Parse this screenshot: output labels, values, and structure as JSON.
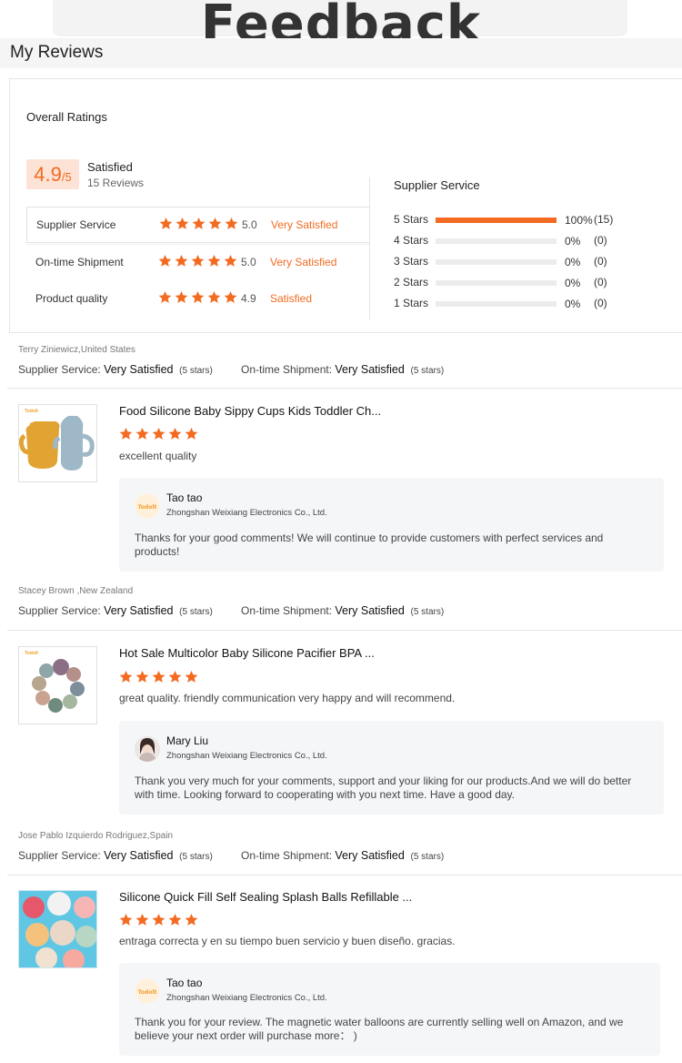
{
  "banner": {
    "title": "Feedback"
  },
  "page": {
    "title": "My Reviews"
  },
  "overall": {
    "label": "Overall Ratings",
    "score": "4.9",
    "out_of": "/5",
    "status": "Satisfied",
    "count": "15 Reviews",
    "metrics": [
      {
        "label": "Supplier Service",
        "stars": 5,
        "value": "5.0",
        "text": "Very Satisfied"
      },
      {
        "label": "On-time Shipment",
        "stars": 5,
        "value": "5.0",
        "text": "Very Satisfied"
      },
      {
        "label": "Product quality",
        "stars": 5,
        "value": "4.9",
        "text": "Satisfied"
      }
    ]
  },
  "supplier_service": {
    "title": "Supplier Service",
    "distribution": [
      {
        "label": "5 Stars",
        "fraction": 1.0,
        "pct": "100%",
        "count": "(15)"
      },
      {
        "label": "4 Stars",
        "fraction": 0,
        "pct": "0%",
        "count": "(0)"
      },
      {
        "label": "3 Stars",
        "fraction": 0,
        "pct": "0%",
        "count": "(0)"
      },
      {
        "label": "2 Stars",
        "fraction": 0,
        "pct": "0%",
        "count": "(0)"
      },
      {
        "label": "1 Stars",
        "fraction": 0,
        "pct": "0%",
        "count": "(0)"
      }
    ]
  },
  "colors": {
    "accent": "#f26b21",
    "accent_bg": "#fde3d6",
    "reply_bg": "#f5f6f8"
  },
  "labels": {
    "supplier_service": "Supplier Service:",
    "on_time": "On-time Shipment:"
  },
  "reviews": [
    {
      "author": "Terry Ziniewicz,United States",
      "supplier_rating": "Very Satisfied",
      "supplier_stars": "(5 stars)",
      "shipment_rating": "Very Satisfied",
      "shipment_stars": "(5 stars)",
      "product_title": "Food Silicone Baby Sippy Cups Kids Toddler Ch...",
      "product_icon": "sippy-cups-image",
      "brand": "Todolt",
      "stars": 5,
      "comment": "excellent quality",
      "reply": {
        "name": "Tao tao",
        "company": "Zhongshan Weixiang Electronics Co., Ltd.",
        "text": "Thanks for your good comments! We will continue to provide customers with perfect services and products!"
      }
    },
    {
      "author": "Stacey Brown ,New Zealand",
      "supplier_rating": "Very Satisfied",
      "supplier_stars": "(5 stars)",
      "shipment_rating": "Very Satisfied",
      "shipment_stars": "(5 stars)",
      "product_title": "Hot Sale Multicolor Baby Silicone Pacifier BPA ...",
      "product_icon": "pacifier-ring-image",
      "brand": "Todolt",
      "stars": 5,
      "comment": "great quality. friendly communication very happy and will recommend.",
      "reply": {
        "name": "Mary Liu",
        "company": "Zhongshan Weixiang Electronics Co., Ltd.",
        "text": "Thank you very much for your comments, support and your liking for our products.And we will do better with time. Looking forward to cooperating with you next time. Have a good day."
      }
    },
    {
      "author": "Jose Pablo Izquierdo Rodriguez,Spain",
      "supplier_rating": "Very Satisfied",
      "supplier_stars": "(5 stars)",
      "shipment_rating": "Very Satisfied",
      "shipment_stars": "(5 stars)",
      "product_title": "Silicone Quick Fill Self Sealing Splash Balls Refillable ...",
      "product_icon": "splash-balls-image",
      "stars": 5,
      "comment": "entraga correcta y en su tiempo buen servicio y buen diseño. gracias.",
      "reply": {
        "name": "Tao tao",
        "company": "Zhongshan Weixiang Electronics Co., Ltd.",
        "text": "Thank you for your review. The magnetic water balloons are currently selling well on Amazon, and we believe your next order will purchase more： )"
      }
    }
  ]
}
